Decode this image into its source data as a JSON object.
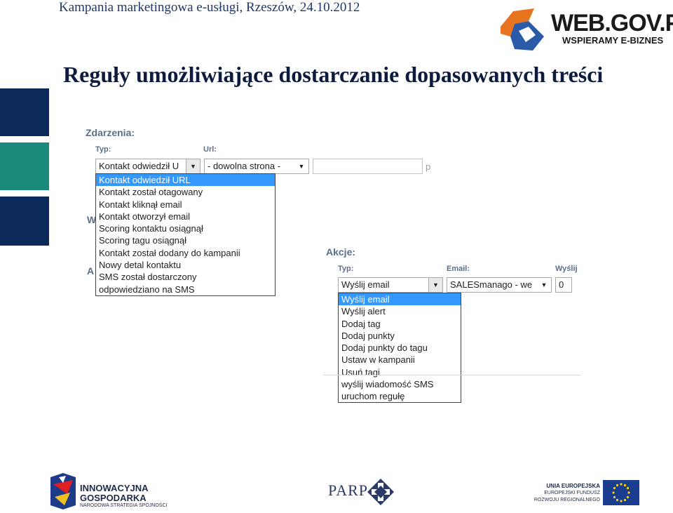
{
  "header": {
    "line": "Kampania marketingowa e-usługi, Rzeszów, 24.10.2012"
  },
  "slide": {
    "title": "Reguły umożliwiające dostarczanie dopasowanych treści"
  },
  "logo_webgov": {
    "name": "WEB.GOV.PL",
    "tagline": "WSPIERAMY E-BIZNES"
  },
  "events": {
    "section_label": "Zdarzenia:",
    "type_label": "Typ:",
    "url_label": "Url:",
    "type_value": "Kontakt odwiedził U",
    "url_value": "- dowolna strona -",
    "trailing_char": "p",
    "hidden_label_1": "W",
    "hidden_label_2": "A",
    "options": [
      "Kontakt odwiedził URL",
      "Kontakt został otagowany",
      "Kontakt kliknął email",
      "Kontakt otworzył email",
      "Scoring kontaktu osiągnął",
      "Scoring tagu osiągnął",
      "Kontakt został dodany do kampanii",
      "Nowy detal kontaktu",
      "SMS został dostarczony",
      "odpowiedziano na SMS"
    ],
    "selected_index": 0
  },
  "actions": {
    "section_label": "Akcje:",
    "type_label": "Typ:",
    "email_label": "Email:",
    "send_label": "Wyślij",
    "type_value": "Wyślij email",
    "email_value": "SALESmanago - we",
    "send_value": "0",
    "options": [
      "Wyślij email",
      "Wyślij alert",
      "Dodaj tag",
      "Dodaj punkty",
      "Dodaj punkty do tagu",
      "Ustaw w kampanii",
      "Usuń tagi",
      "wyślij wiadomość SMS",
      "uruchom regułę"
    ],
    "selected_index": 0
  },
  "footer": {
    "ig_line1": "INNOWACYJNA",
    "ig_line2": "GOSPODARKA",
    "ig_line3": "NARODOWA STRATEGIA SPÓJNOŚCI",
    "parp": "PARP",
    "ue_line1": "UNIA EUROPEJSKA",
    "ue_line2": "EUROPEJSKI FUNDUSZ",
    "ue_line3": "ROZWOJU REGIONALNEGO"
  },
  "colors": {
    "title_text": "#0d1b3e",
    "header_text": "#1f3864",
    "bar_navy": "#0b2a5a",
    "bar_teal": "#1a8a7a",
    "selection_blue": "#3399ff",
    "logo_orange": "#e8731e",
    "logo_blue": "#2a5aa8"
  },
  "icons": {
    "dropdown_arrow": "chevron-down-icon",
    "webgov_logo": "webgov-logo-icon",
    "ig_logo": "innowacyjna-gospodarka-logo-icon",
    "parp_logo": "parp-logo-icon",
    "eu_flag": "eu-flag-icon"
  }
}
